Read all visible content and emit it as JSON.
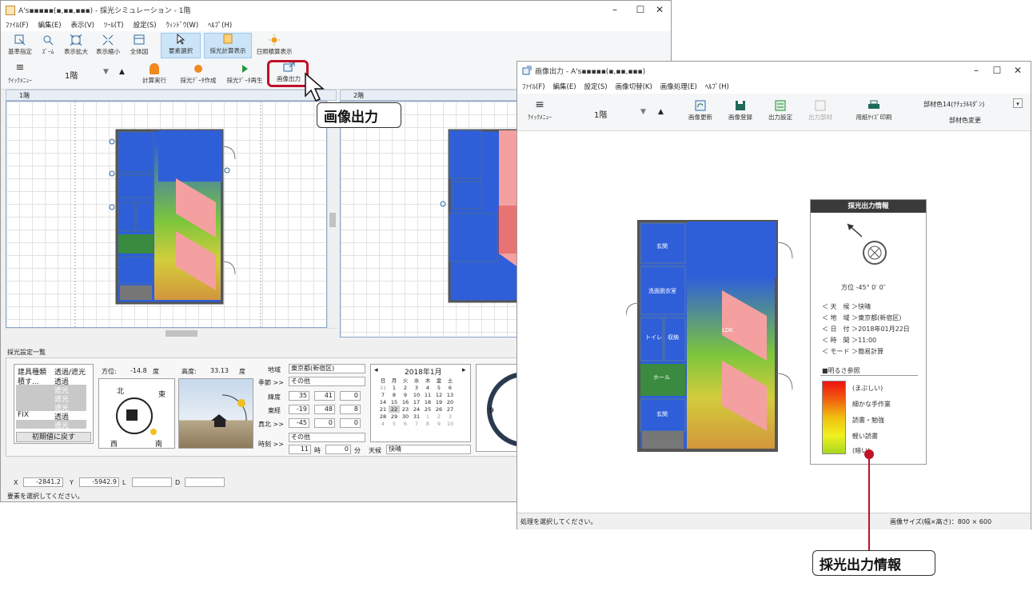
{
  "main_window": {
    "title": "A's▪▪▪▪▪(▪,▪▪,▪▪▪) - 採光シミュレーション - 1階",
    "menu": [
      "ﾌｧｲﾙ(F)",
      "編集(E)",
      "表示(V)",
      "ﾂｰﾙ(T)",
      "設定(S)",
      "ｳｨﾝﾄﾞｳ(W)",
      "ﾍﾙﾌﾟ(H)"
    ],
    "toolbar1": [
      "基準指定",
      "ｽﾞｰﾑ",
      "表示拡大",
      "表示縮小",
      "全体図",
      "要素選択",
      "採光計算表示",
      "日照積算表示"
    ],
    "quick_menu": "ｸｲｯｸﾒﾆｭｰ",
    "floor": "1階",
    "toolbar2": [
      "計算実行",
      "採光ﾃﾞｰﾀ作成",
      "採光ﾃﾞｰﾀ再生",
      "画像出力"
    ],
    "pane1_title": "1階",
    "pane2_title": "2階",
    "settings_title": "採光設定一覧",
    "fixture_table": {
      "headers": [
        "建具種類",
        "透過/遮光"
      ],
      "rows": [
        [
          "積す...",
          "透過"
        ],
        [
          "",
          "遮光"
        ],
        [
          "",
          "遮光"
        ],
        [
          "",
          "遮光"
        ],
        [
          "FIX",
          "透過"
        ],
        [
          "",
          "遮光"
        ]
      ],
      "reset_button": "初期値に戻す"
    },
    "azimuth": {
      "label": "方位:",
      "value": "-14.8",
      "unit": "度",
      "north": "北",
      "east": "東",
      "west": "西",
      "south": "南"
    },
    "altitude": {
      "label": "高度:",
      "value": "33.13",
      "unit": "度"
    },
    "region": {
      "label": "地域",
      "value": "東京都(新宿区)"
    },
    "season": {
      "label": "季節 >>",
      "value": "その他"
    },
    "latitude": {
      "label": "緯度",
      "deg": "35",
      "min": "41",
      "sec": "0"
    },
    "longitude": {
      "label": "東経",
      "deg": "-19",
      "min": "48",
      "sec": "8"
    },
    "true_north": {
      "label": "真北 >>",
      "deg": "-45",
      "min": "0",
      "sec": "0"
    },
    "time": {
      "label": "時刻 >>",
      "preset": "その他",
      "hour": "11",
      "hour_unit": "時",
      "minute": "0",
      "minute_unit": "分"
    },
    "weather": {
      "label": "天候",
      "value": "快晴"
    },
    "calendar": {
      "title": "2018年1月",
      "weekdays": [
        "日",
        "月",
        "火",
        "水",
        "木",
        "金",
        "土"
      ],
      "weeks": [
        [
          "31",
          "1",
          "2",
          "3",
          "4",
          "5",
          "6"
        ],
        [
          "7",
          "8",
          "9",
          "10",
          "11",
          "12",
          "13"
        ],
        [
          "14",
          "15",
          "16",
          "17",
          "18",
          "19",
          "20"
        ],
        [
          "21",
          "22",
          "23",
          "24",
          "25",
          "26",
          "27"
        ],
        [
          "28",
          "29",
          "30",
          "31",
          "1",
          "2",
          "3"
        ],
        [
          "4",
          "5",
          "6",
          "7",
          "8",
          "9",
          "10"
        ]
      ]
    },
    "coords": {
      "x_label": "X",
      "x": "-2841.2",
      "y_label": "Y",
      "y": "-5942.9",
      "l_label": "L",
      "d_label": "D"
    },
    "status": "要素を選択してください。"
  },
  "image_window": {
    "title": "画像出力 - A's▪▪▪▪▪(▪,▪▪,▪▪▪)",
    "menu": [
      "ﾌｧｲﾙ(F)",
      "編集(E)",
      "設定(S)",
      "画像切替(K)",
      "画像処理(E)",
      "ﾍﾙﾌﾟ(H)"
    ],
    "quick_menu": "ｸｲｯｸﾒﾆｭｰ",
    "floor": "1階",
    "toolbar": [
      "画像更新",
      "画像登録",
      "出力設定",
      "出力部材",
      "用紙ｻｲｽﾞ印刷"
    ],
    "material_select": "部材色14(ﾅﾁｭﾗﾙﾓﾀﾞﾝ)",
    "material_button": "部材色変更",
    "info_panel": {
      "title": "採光出力情報",
      "azimuth": "方位 -45°  0′ 0″",
      "rows": [
        "＜ 天　候 ＞快晴",
        "＜ 地　域 ＞東京都(新宿区)",
        "＜ 日　付 ＞2018年01月22日",
        "＜ 時　間 ＞11:00",
        "＜ モード ＞簡易計算"
      ],
      "legend_title": "■明るさ参照",
      "legend": [
        "(まぶしい)",
        "細かな手作業",
        "読書・勉強",
        "軽い読書",
        "(暗い)"
      ]
    },
    "rooms": [
      "玄関",
      "洗面脱衣室",
      "トイレ",
      "収納",
      "ホール",
      "玄関",
      "LDK"
    ],
    "status": "処理を選択してください。",
    "image_size": "画像サイズ(幅×高さ)：800 × 600"
  },
  "callouts": {
    "export_button": "画像出力",
    "info_label": "採光出力情報"
  },
  "colors": {
    "accent_red": "#c0102a",
    "selected": "#cce4f7",
    "heat_blue": "#2f5fd8",
    "heat_pink": "#f4a0a0"
  }
}
